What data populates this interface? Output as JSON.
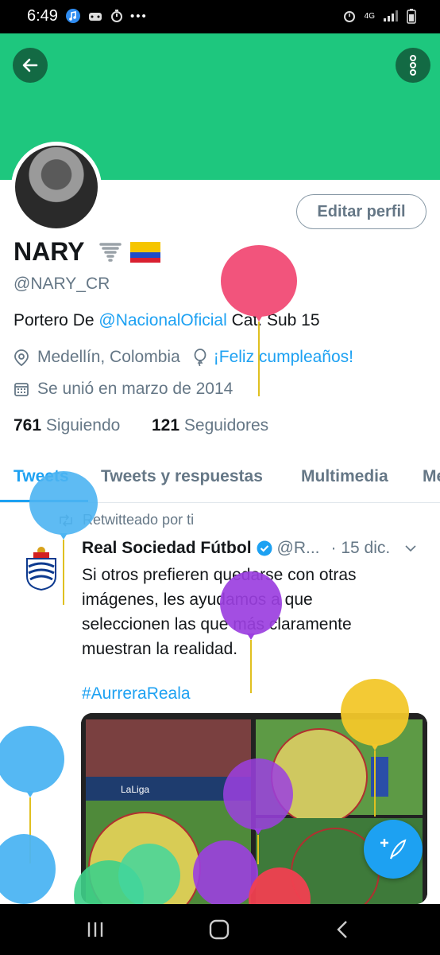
{
  "status_bar": {
    "time": "6:49",
    "network": "4G"
  },
  "profile": {
    "edit_label": "Editar perfil",
    "name": "NARY",
    "handle": "@NARY_CR",
    "bio_prefix": "Portero De ",
    "bio_mention": "@NacionalOficial",
    "bio_suffix": " Cat. Sub 15",
    "location": "Medellín, Colombia",
    "birthday": "¡Feliz cumpleaños!",
    "joined": "Se unió en marzo de 2014",
    "following_count": "761",
    "following_label": "Siguiendo",
    "followers_count": "121",
    "followers_label": "Seguidores"
  },
  "tabs": [
    "Tweets",
    "Tweets y respuestas",
    "Multimedia",
    "Me"
  ],
  "tweet": {
    "retweet_label": "Retwitteado por ti",
    "author": "Real Sociedad Fútbol",
    "handle": "@R...",
    "date": "· 15 dic.",
    "text_lines": [
      "Si otros prefieren quedarse con otras",
      "imágenes, les ayudamos a que",
      "seleccionen las que más claramente",
      "muestran la realidad."
    ],
    "hashtag": "#AurreraReala"
  },
  "icons": {
    "back": "arrow-left-icon",
    "more": "more-vertical-icon",
    "location": "location-pin-icon",
    "birthday": "balloon-icon",
    "calendar": "calendar-icon",
    "retweet": "retweet-icon",
    "verified": "verified-badge-icon",
    "compose": "compose-tweet-icon"
  },
  "colors": {
    "header": "#1ec77e",
    "accent": "#1da1f2",
    "muted": "#657786"
  }
}
